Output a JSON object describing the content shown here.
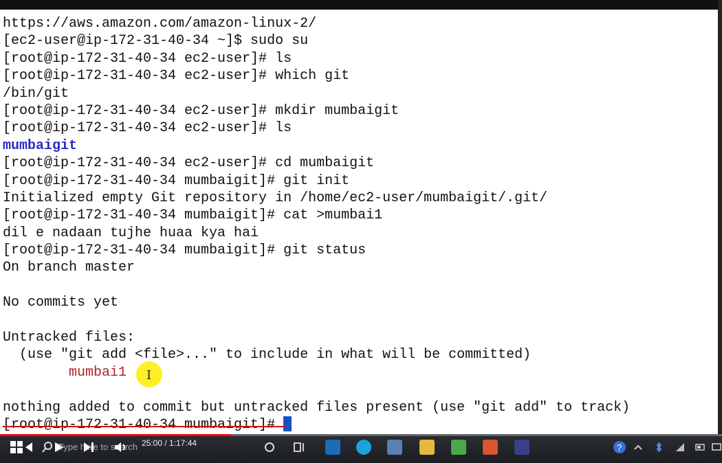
{
  "terminal": {
    "lines": [
      {
        "text": "https://aws.amazon.com/amazon-linux-2/",
        "kind": "normal"
      },
      {
        "text": "[ec2-user@ip-172-31-40-34 ~]$ sudo su",
        "kind": "normal"
      },
      {
        "text": "[root@ip-172-31-40-34 ec2-user]# ls",
        "kind": "normal"
      },
      {
        "text": "[root@ip-172-31-40-34 ec2-user]# which git",
        "kind": "normal"
      },
      {
        "text": "/bin/git",
        "kind": "normal"
      },
      {
        "text": "[root@ip-172-31-40-34 ec2-user]# mkdir mumbaigit",
        "kind": "normal"
      },
      {
        "text": "[root@ip-172-31-40-34 ec2-user]# ls",
        "kind": "normal"
      },
      {
        "text": "mumbaigit",
        "kind": "dir"
      },
      {
        "text": "[root@ip-172-31-40-34 ec2-user]# cd mumbaigit",
        "kind": "normal"
      },
      {
        "text": "[root@ip-172-31-40-34 mumbaigit]# git init",
        "kind": "normal"
      },
      {
        "text": "Initialized empty Git repository in /home/ec2-user/mumbaigit/.git/",
        "kind": "normal"
      },
      {
        "text": "[root@ip-172-31-40-34 mumbaigit]# cat >mumbai1",
        "kind": "normal"
      },
      {
        "text": "dil e nadaan tujhe huaa kya hai",
        "kind": "normal"
      },
      {
        "text": "[root@ip-172-31-40-34 mumbaigit]# git status",
        "kind": "normal"
      },
      {
        "text": "On branch master",
        "kind": "normal"
      },
      {
        "text": "",
        "kind": "normal"
      },
      {
        "text": "No commits yet",
        "kind": "normal"
      },
      {
        "text": "",
        "kind": "normal"
      },
      {
        "text": "Untracked files:",
        "kind": "normal"
      },
      {
        "text": "  (use \"git add <file>...\" to include in what will be committed)",
        "kind": "normal"
      },
      {
        "text": "        mumbai1",
        "kind": "untracked"
      },
      {
        "text": "",
        "kind": "normal"
      },
      {
        "text": "nothing added to commit but untracked files present (use \"git add\" to track)",
        "kind": "normal"
      }
    ],
    "prompt": "[root@ip-172-31-40-34 mumbaigit]# "
  },
  "video": {
    "time": "25:00 / 1:17:44",
    "progress": 0.32
  },
  "taskbar": {
    "search_placeholder": "Type here to search",
    "icons": [
      "windows-start-icon",
      "prev-icon",
      "play-icon",
      "next-icon",
      "volume-icon",
      "cortana-icon",
      "task-view-icon",
      "app-icon",
      "edge-icon",
      "app2-icon",
      "file-explorer-icon",
      "green-app-icon",
      "red-app-icon",
      "network-app-icon",
      "help-icon",
      "chevron-up-icon",
      "bluetooth-icon",
      "wifi-icon",
      "battery-icon",
      "screen-icon"
    ]
  },
  "colors": {
    "dir": "#2a2ac4",
    "untracked": "#b52222",
    "cursor": "#1452c8"
  }
}
